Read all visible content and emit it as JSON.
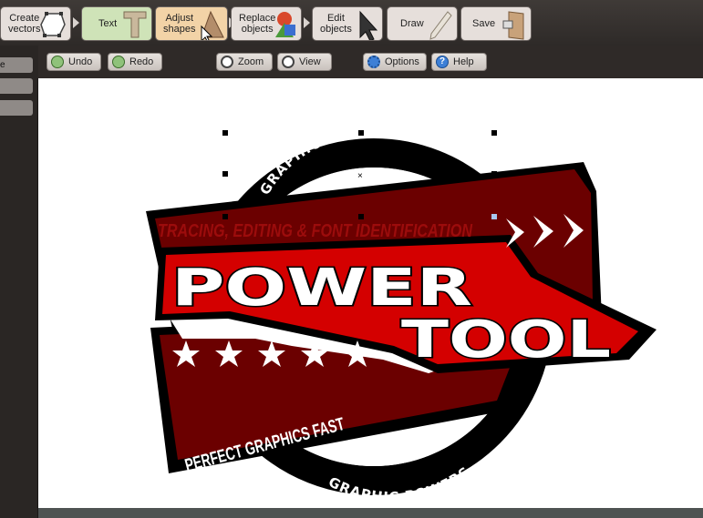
{
  "toolbar": {
    "create_vectors": "Create\nvectors",
    "text": "Text",
    "adjust_shapes": "Adjust\nshapes",
    "replace_objects": "Replace\nobjects",
    "edit_objects": "Edit\nobjects",
    "draw": "Draw",
    "save": "Save"
  },
  "subtoolbar": {
    "undo": "Undo",
    "redo": "Redo",
    "zoom": "Zoom",
    "view": "View",
    "options": "Options",
    "help": "Help"
  },
  "sidebar": {
    "tab1": "e"
  },
  "logo": {
    "top_arc": "GRAPHIC TRACER",
    "banner": "TRACING, EDITING & FONT IDENTIFICATION",
    "power": "POWER",
    "tool": "TOOL",
    "tagline": "PERFECT GRAPHICS FAST",
    "bottom_arc": "GRAPHIC POWERS"
  },
  "colors": {
    "dark_red": "#6b0000",
    "red": "#d40000",
    "black": "#000000",
    "white": "#ffffff",
    "btn_green": "#cfe3b8",
    "btn_orange": "#f2d3a7",
    "btn_gray": "#e6dfdb"
  }
}
